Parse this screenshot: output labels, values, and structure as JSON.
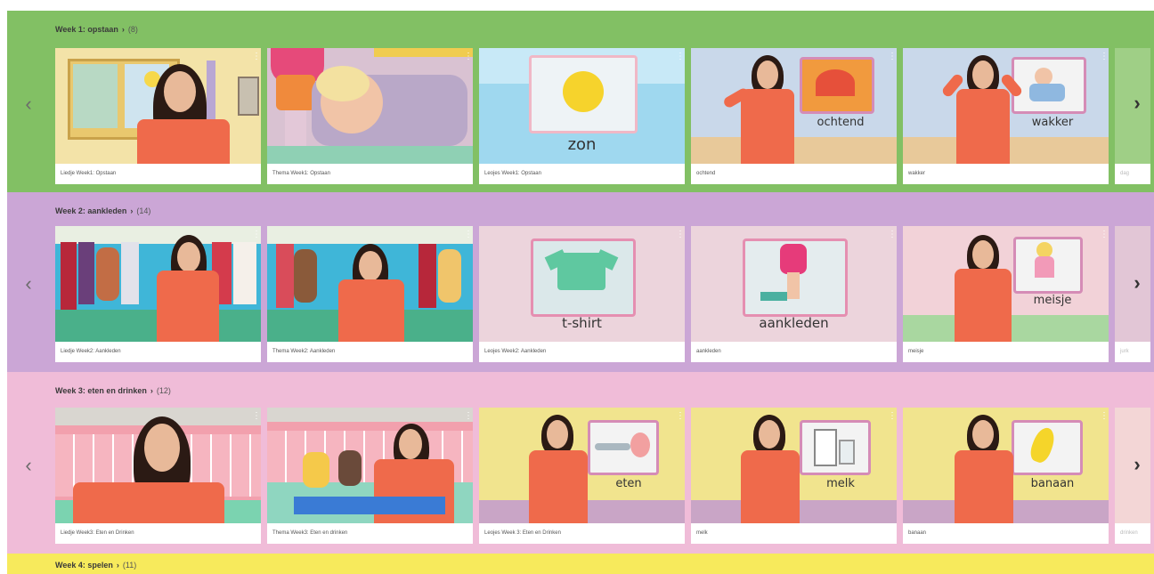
{
  "sections": [
    {
      "title": "Week 1: opstaan",
      "count": "(8)",
      "bg": "#82c064",
      "cards": [
        {
          "caption": "Liedje Week1: Opstaan"
        },
        {
          "caption": "Thema Week1: Opstaan"
        },
        {
          "caption": "Leojes Week1: Opstaan",
          "word": "zon"
        },
        {
          "caption": "ochtend",
          "word": "ochtend"
        },
        {
          "caption": "wakker",
          "word": "wakker"
        }
      ],
      "peek_caption": "dag"
    },
    {
      "title": "Week 2: aankleden",
      "count": "(14)",
      "bg": "#cba6d6",
      "cards": [
        {
          "caption": "Liedje Week2: Aankleden"
        },
        {
          "caption": "Thema Week2: Aankleden"
        },
        {
          "caption": "Leojes Week2: Aankleden",
          "word": "t-shirt"
        },
        {
          "caption": "aankleden",
          "word": "aankleden"
        },
        {
          "caption": "meisje",
          "word": "meisje"
        }
      ],
      "peek_caption": "jurk"
    },
    {
      "title": "Week 3: eten en drinken",
      "count": "(12)",
      "bg": "#f0bcd8",
      "cards": [
        {
          "caption": "Liedje Week3: Eten en Drinken"
        },
        {
          "caption": "Thema Week3: Eten en drinken"
        },
        {
          "caption": "Leojes Week 3: Eten en Drinken",
          "word": "eten"
        },
        {
          "caption": "melk",
          "word": "melk"
        },
        {
          "caption": "banaan",
          "word": "banaan"
        }
      ],
      "peek_caption": "drinken"
    },
    {
      "title": "Week 4: spelen",
      "count": "(11)",
      "bg": "#f7ea5c"
    }
  ],
  "icons": {
    "prev": "‹",
    "next": "›",
    "chevron": "›",
    "more": "⋮"
  }
}
